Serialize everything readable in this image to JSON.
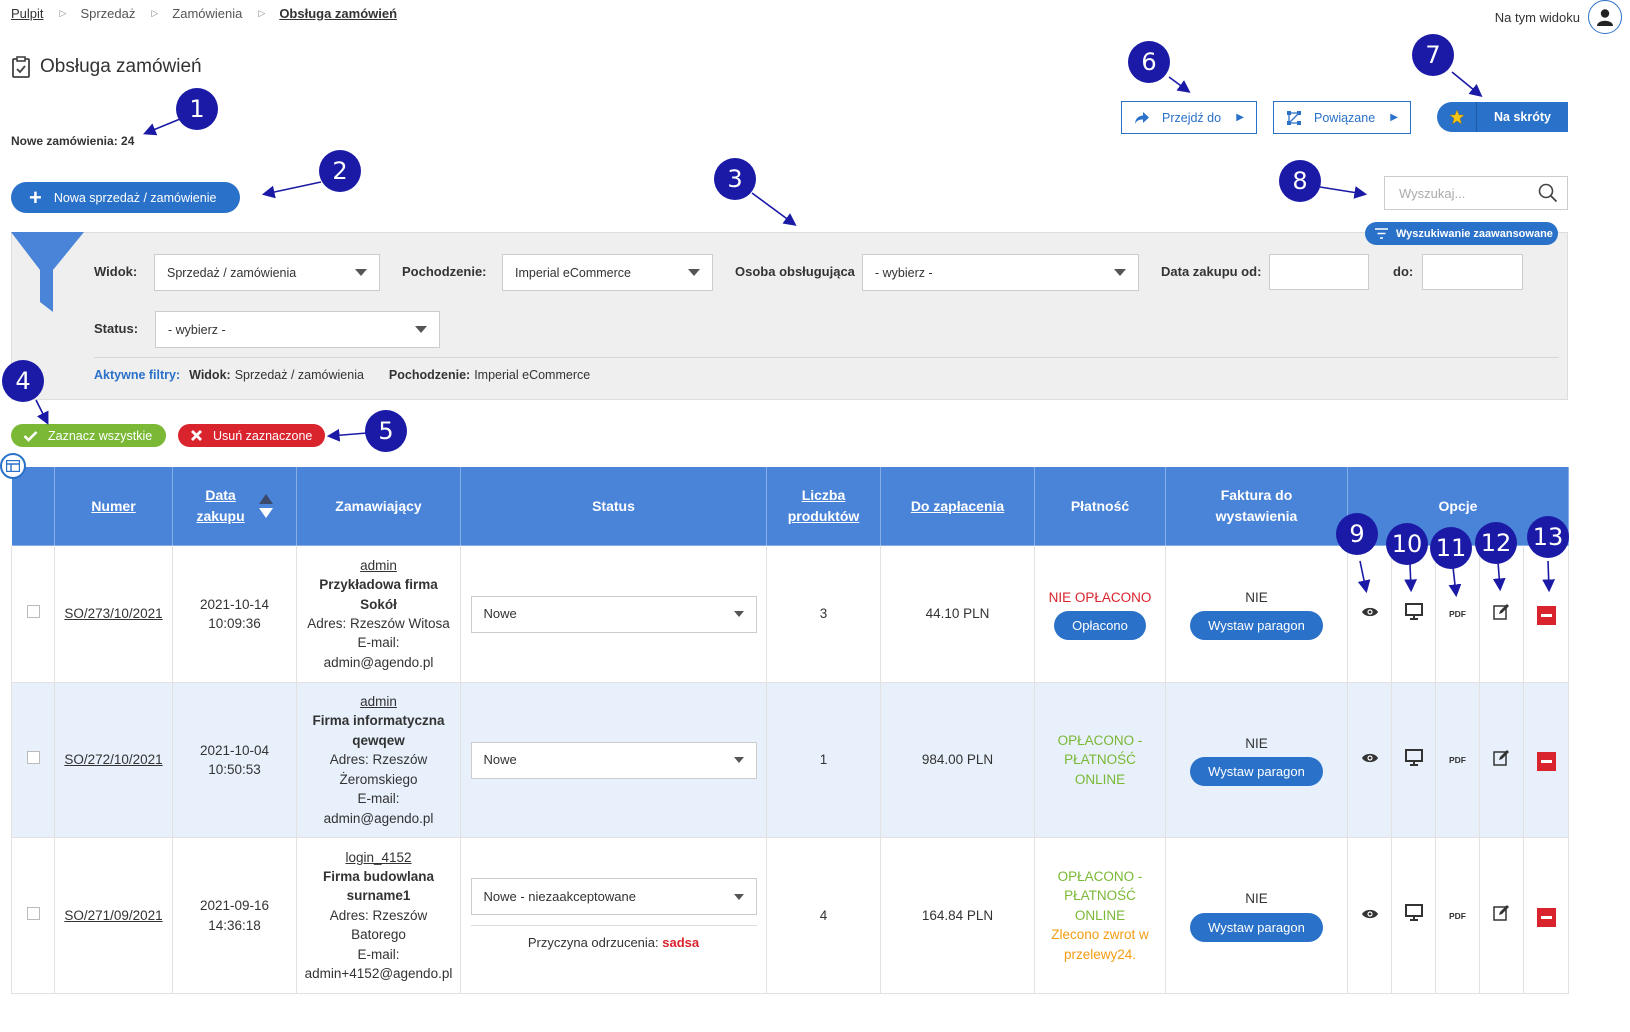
{
  "breadcrumb": [
    "Pulpit",
    "Sprzedaż",
    "Zamówienia",
    "Obsługa zamówień"
  ],
  "header": {
    "view_user_label": "Na tym widoku",
    "page_title": "Obsługa zamówień",
    "new_orders": "Nowe zamówienia: 24"
  },
  "toolbar": {
    "new_sale": "Nowa sprzedaż / zamówienie",
    "goto": "Przejdź do",
    "related": "Powiązane",
    "shortcuts": "Na skróty"
  },
  "search": {
    "placeholder": "Wyszukaj...",
    "advanced": "Wyszukiwanie zaawansowane"
  },
  "filters": {
    "view_label": "Widok:",
    "view_value": "Sprzedaż / zamówienia",
    "origin_label": "Pochodzenie:",
    "origin_value": "Imperial eCommerce",
    "handler_label": "Osoba obsługująca",
    "handler_value": "- wybierz -",
    "date_from_label": "Data zakupu od:",
    "date_from_value": "",
    "date_to_label": "do:",
    "date_to_value": "",
    "status_label": "Status:",
    "status_value": "- wybierz -",
    "active_title": "Aktywne filtry:",
    "active_view_key": "Widok:",
    "active_view_value": "Sprzedaż / zamówienia",
    "active_origin_key": "Pochodzenie:",
    "active_origin_value": "Imperial eCommerce"
  },
  "bulk": {
    "select_all": "Zaznacz wszystkie",
    "delete_selected": "Usuń zaznaczone"
  },
  "table": {
    "headers": {
      "number": "Numer",
      "date_l1": "Data",
      "date_l2": "zakupu",
      "customer": "Zamawiający",
      "status": "Status",
      "count_l1": "Liczba",
      "count_l2": "produktów",
      "to_pay": "Do zapłacenia",
      "payment": "Płatność",
      "invoice_l1": "Faktura do",
      "invoice_l2": "wystawienia",
      "options": "Opcje"
    },
    "pdf_label": "PDF",
    "rows": [
      {
        "number": "SO/273/10/2021",
        "date": "2021-10-14",
        "time": "10:09:36",
        "login": "admin",
        "company_l1": "Przykładowa firma",
        "company_l2": "Sokół",
        "address_l1": "Adres: Rzeszów Witosa",
        "address_l2": "",
        "email_label": "E-mail:",
        "email": "admin@agendo.pl",
        "status": "Nowe",
        "count": "3",
        "to_pay": "44.10 PLN",
        "payment_l1": "NIE OPŁACONO",
        "payment_button": "Opłacono",
        "invoice": "NIE",
        "invoice_button": "Wystaw paragon"
      },
      {
        "number": "SO/272/10/2021",
        "date": "2021-10-04",
        "time": "10:50:53",
        "login": "admin",
        "company_l1": "Firma informatyczna",
        "company_l2": "qewqew",
        "address_l1": "Adres: Rzeszów",
        "address_l2": "Żeromskiego",
        "email_label": "E-mail:",
        "email": "admin@agendo.pl",
        "status": "Nowe",
        "count": "1",
        "to_pay": "984.00 PLN",
        "payment_l1": "OPŁACONO -",
        "payment_l2": "PŁATNOŚĆ",
        "payment_l3": "ONLINE",
        "invoice": "NIE",
        "invoice_button": "Wystaw paragon"
      },
      {
        "number": "SO/271/09/2021",
        "date": "2021-09-16",
        "time": "14:36:18",
        "login": "login_4152",
        "company_l1": "Firma budowlana",
        "company_l2": "surname1",
        "address_l1": "Adres: Rzeszów",
        "address_l2": "Batorego",
        "email_label": "E-mail:",
        "email": "admin+4152@agendo.pl",
        "status": "Nowe - niezaakceptowane",
        "reject_label": "Przyczyna odrzucenia:",
        "reject_value": "sadsa",
        "count": "4",
        "to_pay": "164.84 PLN",
        "payment_l1": "OPŁACONO -",
        "payment_l2": "PŁATNOŚĆ",
        "payment_l3": "ONLINE",
        "refund_l1": "Zlecono zwrot w",
        "refund_l2": "przelewy24.",
        "invoice": "NIE",
        "invoice_button": "Wystaw paragon"
      }
    ]
  },
  "markers": [
    "1",
    "2",
    "3",
    "4",
    "5",
    "6",
    "7",
    "8",
    "9",
    "10",
    "11",
    "12",
    "13"
  ],
  "colors": {
    "primary": "#2a71c9",
    "header": "#4a84d8",
    "success": "#7ab836",
    "danger": "#d9232d",
    "marker": "#1a1aa6",
    "warning": "#f39c12"
  }
}
